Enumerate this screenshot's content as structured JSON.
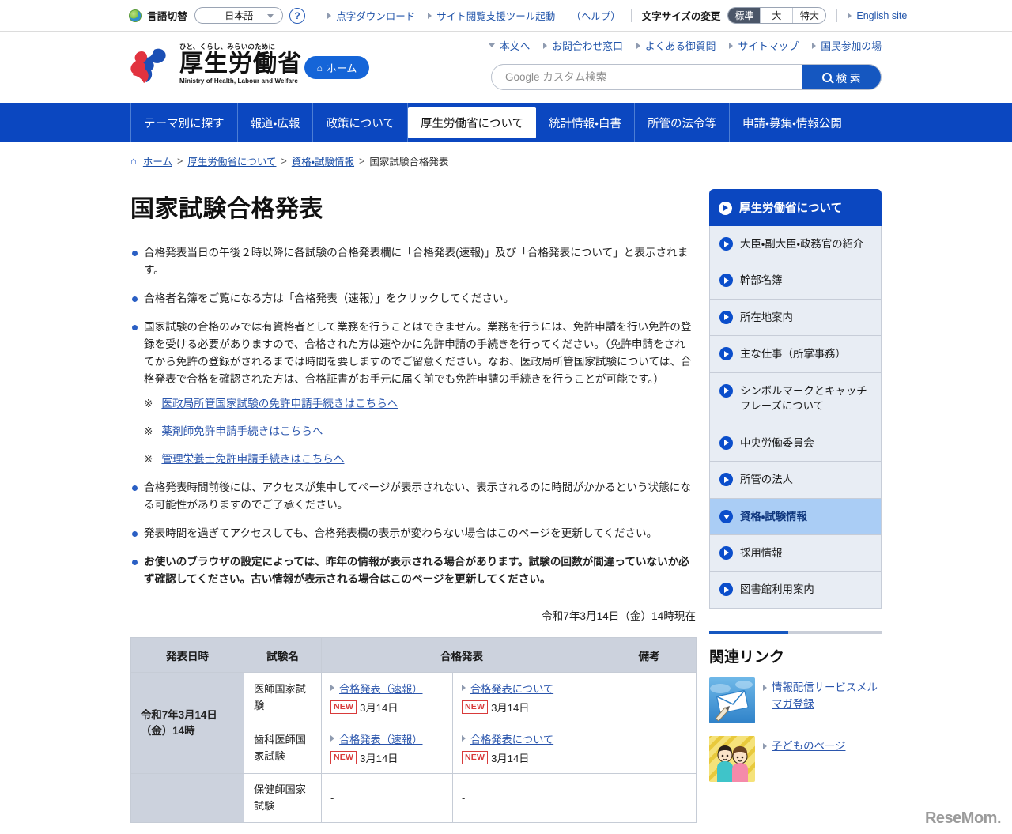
{
  "utility": {
    "globe_icon": "globe-icon",
    "language_label": "言語切替",
    "language_selected": "日本語",
    "help_icon": "question-mark-icon",
    "links": [
      {
        "label": "点字ダウンロード"
      },
      {
        "label": "サイト閲覧支援ツール起動"
      }
    ],
    "help_paren": "（ヘルプ）",
    "fontsize_label": "文字サイズの変更",
    "fontsize_options": [
      {
        "label": "標準",
        "active": true
      },
      {
        "label": "大",
        "active": false
      },
      {
        "label": "特大",
        "active": false
      }
    ],
    "english_site": "English site"
  },
  "header": {
    "logo_tagline": "ひと、くらし、みらいのために",
    "logo_main": "厚生労働省",
    "logo_en": "Ministry of Health, Labour and Welfare",
    "home_button": "ホーム",
    "home_icon": "home-icon",
    "links": [
      {
        "label": "本文へ",
        "icon": "chevron-down-icon"
      },
      {
        "label": "お問合わせ窓口",
        "icon": "triangle-right-icon"
      },
      {
        "label": "よくある御質問",
        "icon": "triangle-right-icon"
      },
      {
        "label": "サイトマップ",
        "icon": "triangle-right-icon"
      },
      {
        "label": "国民参加の場",
        "icon": "triangle-right-icon"
      }
    ],
    "search_placeholder": "Google カスタム検索",
    "search_value": "",
    "search_button": "検 索",
    "search_icon": "search-icon"
  },
  "gnav": {
    "items": [
      {
        "label": "テーマ別に探す",
        "current": false
      },
      {
        "label": "報道・広報",
        "current": false
      },
      {
        "label": "政策について",
        "current": false
      },
      {
        "label": "厚生労働省について",
        "current": true
      },
      {
        "label": "統計情報・白書",
        "current": false
      },
      {
        "label": "所管の法令等",
        "current": false
      },
      {
        "label": "申請・募集・情報公開",
        "current": false
      }
    ]
  },
  "breadcrumb": {
    "home_icon": "home-icon",
    "items": [
      {
        "label": "ホーム",
        "link": true
      },
      {
        "label": "厚生労働省について",
        "link": true
      },
      {
        "label": "資格・試験情報",
        "link": true
      },
      {
        "label": "国家試験合格発表",
        "link": false
      }
    ],
    "separator": ">"
  },
  "main": {
    "title": "国家試験合格発表",
    "notes": [
      {
        "text": "合格発表当日の午後２時以降に各試験の合格発表欄に「合格発表(速報)」及び「合格発表について」と表示されます。",
        "bold": false
      },
      {
        "text": "合格者名簿をご覧になる方は「合格発表（速報）」をクリックしてください。",
        "bold": false
      },
      {
        "text": "国家試験の合格のみでは有資格者として業務を行うことはできません。業務を行うには、免許申請を行い免許の登録を受ける必要がありますので、合格された方は速やかに免許申請の手続きを行ってください。（免許申請をされてから免許の登録がされるまでは時間を要しますのでご留意ください。なお、医政局所管国家試験については、合格発表で合格を確認された方は、合格証書がお手元に届く前でも免許申請の手続きを行うことが可能です。）",
        "bold": false,
        "sub_links": [
          {
            "marker": "※",
            "label": "医政局所管国家試験の免許申請手続きはこちらへ"
          },
          {
            "marker": "※",
            "label": "薬剤師免許申請手続きはこちらへ"
          },
          {
            "marker": "※",
            "label": "管理栄養士免許申請手続きはこちらへ"
          }
        ]
      },
      {
        "text": "合格発表時間前後には、アクセスが集中してページが表示されない、表示されるのに時間がかかるという状態になる可能性がありますのでご了承ください。",
        "bold": false
      },
      {
        "text": "発表時間を過ぎてアクセスしても、合格発表欄の表示が変わらない場合はこのページを更新してください。",
        "bold": false
      },
      {
        "text": "お使いのブラウザの設定によっては、昨年の情報が表示される場合があります。試験の回数が間違っていないか必ず確認してください。古い情報が表示される場合はこのページを更新してください。",
        "bold": true
      }
    ],
    "as_of": "令和7年3月14日（金）14時現在",
    "table": {
      "headers": [
        "発表日時",
        "試験名",
        "合格発表",
        "備考"
      ],
      "rows": [
        {
          "date": "令和7年3月14日（金）14時",
          "date_rowspan": 2,
          "exam": "医師国家試験",
          "col_a": {
            "link": "合格発表（速報）",
            "badge": "NEW",
            "date": "3月14日"
          },
          "col_b": {
            "link": "合格発表について",
            "badge": "NEW",
            "date": "3月14日"
          },
          "remark": ""
        },
        {
          "exam": "歯科医師国家試験",
          "col_a": {
            "link": "合格発表（速報）",
            "badge": "NEW",
            "date": "3月14日"
          },
          "col_b": {
            "link": "合格発表について",
            "badge": "NEW",
            "date": "3月14日"
          },
          "remark": ""
        },
        {
          "date": "",
          "date_rowspan": 1,
          "exam": "保健師国家試験",
          "col_a": {
            "dash": "-"
          },
          "col_b": {
            "dash": "-"
          },
          "remark": ""
        }
      ]
    }
  },
  "sidebar": {
    "header": {
      "label": "厚生労働省について",
      "icon": "play-circle-icon"
    },
    "items": [
      {
        "label": "大臣・副大臣・政務官の紹介",
        "active": false,
        "icon": "play-circle-icon"
      },
      {
        "label": "幹部名簿",
        "active": false,
        "icon": "play-circle-icon"
      },
      {
        "label": "所在地案内",
        "active": false,
        "icon": "play-circle-icon"
      },
      {
        "label": "主な仕事（所掌事務）",
        "active": false,
        "icon": "play-circle-icon"
      },
      {
        "label": "シンボルマークとキャッチフレーズについて",
        "active": false,
        "icon": "play-circle-icon"
      },
      {
        "label": "中央労働委員会",
        "active": false,
        "icon": "play-circle-icon"
      },
      {
        "label": "所管の法人",
        "active": false,
        "icon": "play-circle-icon"
      },
      {
        "label": "資格・試験情報",
        "active": true,
        "icon": "play-circle-down-icon"
      },
      {
        "label": "採用情報",
        "active": false,
        "icon": "play-circle-icon"
      },
      {
        "label": "図書館利用案内",
        "active": false,
        "icon": "play-circle-icon"
      }
    ],
    "related": {
      "title": "関連リンク",
      "items": [
        {
          "label": "情報配信サービスメルマガ登録",
          "thumb": "envelope-thumbnail"
        },
        {
          "label": "子どものページ",
          "thumb": "children-thumbnail"
        }
      ]
    }
  },
  "watermark": {
    "text": "ReseMom."
  },
  "colors": {
    "brand_blue": "#0b47c0",
    "link_blue": "#2b56ad",
    "nav_blue": "#0b47c0",
    "table_head": "#ccd2dd",
    "sidebar_item": "#e8edf4",
    "sidebar_active": "#aacdf5",
    "new_badge_red": "#d83a3a"
  }
}
